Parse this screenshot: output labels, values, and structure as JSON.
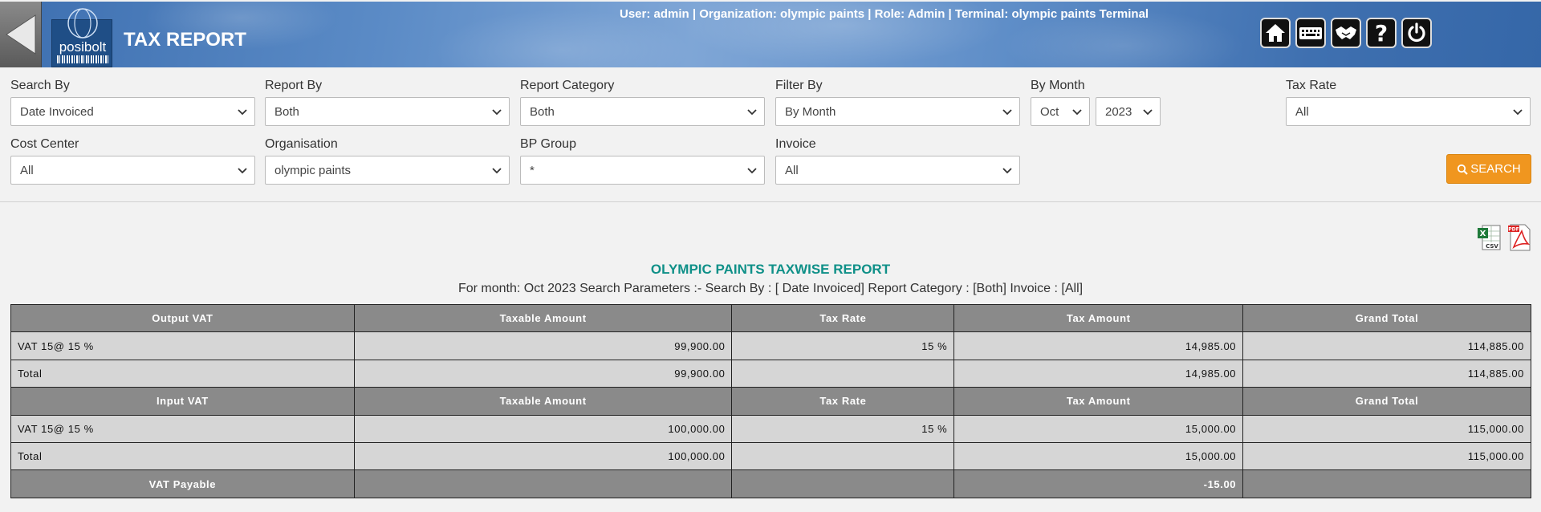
{
  "header": {
    "title": "TAX REPORT",
    "logo_text": "posibolt",
    "user_info": "User: admin | Organization: olympic paints | Role: Admin | Terminal: olympic paints Terminal"
  },
  "filters": {
    "search_by": {
      "label": "Search By",
      "value": "Date Invoiced"
    },
    "report_by": {
      "label": "Report By",
      "value": "Both"
    },
    "report_category": {
      "label": "Report Category",
      "value": "Both"
    },
    "filter_by": {
      "label": "Filter By",
      "value": "By Month"
    },
    "by_month": {
      "label": "By Month",
      "month": "Oct",
      "year": "2023"
    },
    "tax_rate": {
      "label": "Tax Rate",
      "value": "All"
    },
    "cost_center": {
      "label": "Cost Center",
      "value": "All"
    },
    "organisation": {
      "label": "Organisation",
      "value": "olympic paints"
    },
    "bp_group": {
      "label": "BP Group",
      "value": "*"
    },
    "invoice": {
      "label": "Invoice",
      "value": "All"
    },
    "search_label": "SEARCH"
  },
  "report": {
    "title": "OLYMPIC PAINTS TAXWISE REPORT",
    "subtitle": "For month: Oct 2023 Search Parameters :- Search By : [ Date Invoiced] Report Category : [Both] Invoice : [All]",
    "output": {
      "headers": [
        "Output VAT",
        "Taxable Amount",
        "Tax Rate",
        "Tax Amount",
        "Grand Total"
      ],
      "row": {
        "name": "VAT 15@ 15 %",
        "taxable": "99,900.00",
        "rate": "15 %",
        "tax": "14,985.00",
        "grand": "114,885.00"
      },
      "total": {
        "label": "Total",
        "taxable": "99,900.00",
        "tax": "14,985.00",
        "grand": "114,885.00"
      }
    },
    "input": {
      "headers": [
        "Input VAT",
        "Taxable Amount",
        "Tax Rate",
        "Tax Amount",
        "Grand Total"
      ],
      "row": {
        "name": "VAT 15@ 15 %",
        "taxable": "100,000.00",
        "rate": "15 %",
        "tax": "15,000.00",
        "grand": "115,000.00"
      },
      "total": {
        "label": "Total",
        "taxable": "100,000.00",
        "tax": "15,000.00",
        "grand": "115,000.00"
      }
    },
    "payable": {
      "label": "VAT Payable",
      "value": "-15.00"
    }
  },
  "icons": [
    "back-arrow-icon",
    "home-icon",
    "keyboard-icon",
    "handshake-icon",
    "help-icon",
    "power-icon",
    "search-icon",
    "excel-csv-icon",
    "pdf-icon"
  ],
  "colors": {
    "accent": "#f0961f",
    "report_title": "#0f9088",
    "link": "#2222dd",
    "table_header": "#8a8a8a"
  }
}
